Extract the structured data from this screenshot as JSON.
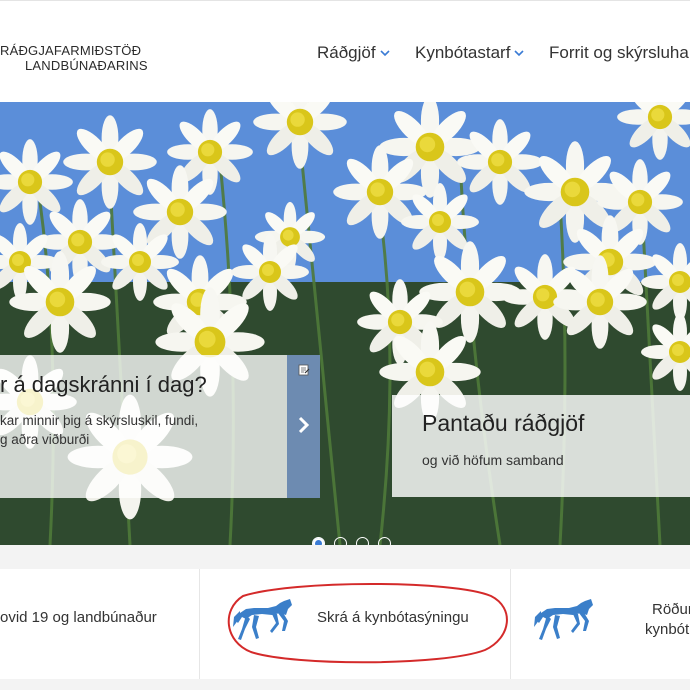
{
  "header": {
    "logo_line1": "RÁÐGJAFARMIÐSTÖÐ",
    "logo_line2": "LANDBÚNAÐARINS",
    "nav": [
      {
        "label": "Ráðgjöf",
        "has_dropdown": true
      },
      {
        "label": "Kynbótastarf",
        "has_dropdown": true
      },
      {
        "label": "Forrit og skýrsluhald",
        "has_dropdown": false
      }
    ]
  },
  "slider": {
    "left_panel": {
      "title": "r á dagskránni í dag?",
      "desc_line1": "kar minnir þig á skýrsluskil, fundi,",
      "desc_line2": "g aðra viðburði"
    },
    "right_panel": {
      "title": "Pantaðu ráðgjöf",
      "desc": "og við höfum samband"
    },
    "dots_count": 4,
    "active_dot": 0
  },
  "tiles": [
    {
      "label": "ovid 19 og landbúnaður"
    },
    {
      "label": "Skrá á kynbótasýningu"
    },
    {
      "label_line1": "Röðun",
      "label_line2": "kynbót"
    }
  ],
  "colors": {
    "accent": "#3a7bd5",
    "horse": "#3b7fc9",
    "annotation": "#d42a2a"
  },
  "icons": {
    "nav_dropdown": "chevron-down-icon",
    "panel_arrow": "chevron-right-icon",
    "panel_note": "note-icon",
    "tile_icon": "horse-icon"
  }
}
